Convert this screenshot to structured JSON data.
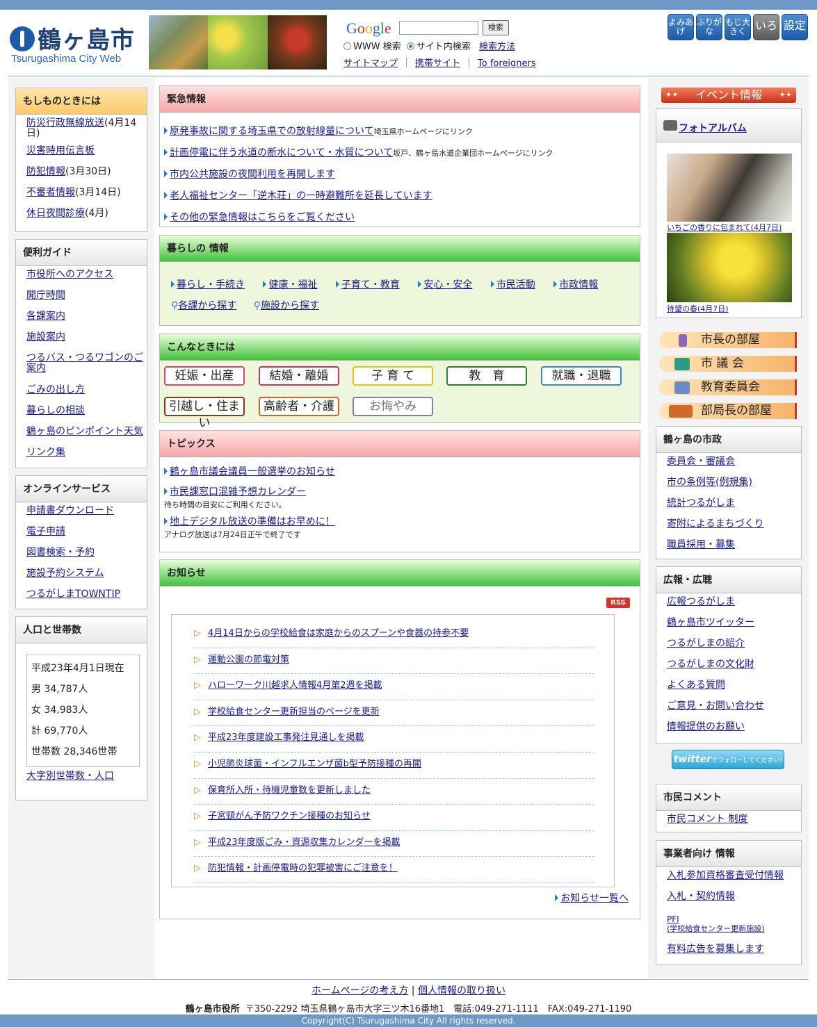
{
  "header": {
    "logo_jp": "鶴ヶ島市",
    "logo_en": "Tsurugashima City Web",
    "google": "Google",
    "search_button": "検索",
    "radio_www": "WWW 検索",
    "radio_site": "サイト内検索",
    "search_help": "検索方法",
    "links": [
      "サイトマップ",
      "携帯サイト",
      "To foreigners"
    ],
    "tools": [
      "よみあげ",
      "ふりがな",
      "もじ大きく",
      "いろ",
      "設定"
    ]
  },
  "left": {
    "emergency": {
      "title": "もしものときには",
      "items": [
        {
          "link": "防災行政無線放送",
          "suffix": "(4月14日)"
        },
        {
          "link": "災害時用伝言板",
          "suffix": ""
        },
        {
          "link": "防犯情報",
          "suffix": "(3月30日)"
        },
        {
          "link": "不審者情報",
          "suffix": "(3月14日)"
        },
        {
          "link": "休日夜間診療",
          "suffix": "(4月)"
        }
      ]
    },
    "guide": {
      "title": "便利ガイド",
      "items": [
        "市役所へのアクセス",
        "開庁時間",
        "各課案内",
        "施設案内",
        "つるバス・つるワゴンのご案内",
        "ごみの出し方",
        "暮らしの相談",
        "鶴ヶ島のピンポイント天気",
        "リンク集"
      ]
    },
    "online": {
      "title": "オンラインサービス",
      "items": [
        "申請書ダウンロード",
        "電子申請",
        "図書検索・予約",
        "施設予約システム",
        "つるがしまTOWNTIP"
      ]
    },
    "population": {
      "title": "人口と世帯数",
      "lines": [
        "平成23年4月1日現在",
        "男 34,787人",
        "女 34,983人",
        "計 69,770人",
        "世帯数 28,346世帯"
      ],
      "link": "大字別世帯数・人口"
    }
  },
  "center": {
    "urgent": {
      "title": "緊急情報",
      "items": [
        {
          "link": "原発事故に関する埼玉県での放射線量について",
          "note": "埼玉県ホームページにリンク"
        },
        {
          "link": "計画停電に伴う水道の断水について・水質について",
          "note": "坂戸、鶴ヶ島水道企業団ホームページにリンク"
        },
        {
          "link": "市内公共施設の夜間利用を再開します",
          "note": ""
        },
        {
          "link": "老人福祉センター「逆木荘」の一時避難所を延長しています",
          "note": ""
        },
        {
          "link": "その他の緊急情報はこちらをご覧ください",
          "note": ""
        }
      ]
    },
    "living": {
      "title": "暮らしの 情報",
      "row1": [
        "暮らし・手続き",
        "健康・福祉",
        "子育て・教育",
        "安心・安全",
        "市民活動",
        "市政情報"
      ],
      "row2": [
        "各課から探す",
        "施設から探す"
      ]
    },
    "situations": {
      "title": "こんなときには",
      "buttons": [
        {
          "label": "妊娠・出産",
          "color": "#d6457a"
        },
        {
          "label": "結婚・離婚",
          "color": "#c8336a"
        },
        {
          "label": "子 育 て",
          "color": "#e8c21a"
        },
        {
          "label": "教　育",
          "color": "#2f7a3a"
        },
        {
          "label": "就職・退職",
          "color": "#3a86c8"
        },
        {
          "label": "引越し・住まい",
          "color": "#7a3a1c"
        },
        {
          "label": "高齢者・介護",
          "color": "#d0632a"
        },
        {
          "label": "お悔やみ",
          "color": "#8a78b0"
        }
      ]
    },
    "topics": {
      "title": "トピックス",
      "items": [
        {
          "link": "鶴ヶ島市議会議員一般選挙のお知らせ",
          "note": ""
        },
        {
          "link": "市民課窓口混雑予想カレンダー",
          "note": "待ち時間の目安にご利用ください。"
        },
        {
          "link": "地上デジタル放送の準備はお早めに！",
          "note": "アナログ放送は7月24日正午で終了です"
        }
      ]
    },
    "news": {
      "title": "お知らせ",
      "rss": "RSS",
      "items": [
        "4月14日からの学校給食は家庭からのスプーンや食器の持参不要",
        "運動公園の節電対策",
        "ハローワーク川越求人情報4月第2週を掲載",
        "学校給食センター更新担当のページを更新",
        "平成23年度建設工事発注見通しを掲載",
        "小児肺炎球菌・インフルエンザ菌b型予防接種の再開",
        "保育所入所・待機児童数を更新しました",
        "子宮頸がん予防ワクチン接種のお知らせ",
        "平成23年度版ごみ・資源収集カレンダーを掲載",
        "防犯情報・計画停電時の犯罪被害にご注意を！"
      ],
      "more": "お知らせ一覧へ"
    }
  },
  "right": {
    "event_banner": "イベント情報",
    "album": {
      "title": "フォトアルバム",
      "photos": [
        {
          "caption": "いちごの香りに包まれて(4月7日)"
        },
        {
          "caption": "待望の春(4月7日)"
        }
      ]
    },
    "menus": [
      {
        "label": "市長の部屋",
        "icon_color": "#8a6ab8"
      },
      {
        "label": "市 議 会",
        "icon_color": "#2a9a8a"
      },
      {
        "label": "教育委員会",
        "icon_color": "#6a8ac8"
      },
      {
        "label": "部局長の部屋",
        "icon_color": "#d06a2a"
      }
    ],
    "city": {
      "title": "鶴ヶ島の市政",
      "items": [
        "委員会・審議会",
        "市の条例等(例規集)",
        "統計つるがしま",
        "寄附によるまちづくり",
        "職員採用・募集"
      ]
    },
    "pr": {
      "title": "広報・広聴",
      "items": [
        "広報つるがしま",
        "鶴ヶ島市ツイッター",
        "つるがしまの紹介",
        "つるがしまの文化財",
        "よくある質問",
        "ご意見・お問い合わせ",
        "情報提供のお願い"
      ]
    },
    "twitter": {
      "logo": "twitter",
      "text": "でフォローしてください!"
    },
    "comment": {
      "title": "市民コメント",
      "items": [
        "市民コメント 制度"
      ]
    },
    "business": {
      "title": "事業者向け 情報",
      "items": [
        "入札参加資格審査受付情報",
        "入札・契約情報"
      ],
      "pfi": "PFI",
      "pfi_sub": "(学校給食センター更新施設)",
      "last": "有料広告を募集します"
    }
  },
  "footer": {
    "links": [
      "ホームページの考え方",
      "個人情報の取り扱い"
    ],
    "office": "鶴ヶ島市役所",
    "address": "〒350-2292 埼玉県鶴ヶ島市大字三ツ木16番地1　電話:049-271-1111　FAX:049-271-1190",
    "copyright": "Copyright(C) Tsurugashima City All rights reserved."
  }
}
